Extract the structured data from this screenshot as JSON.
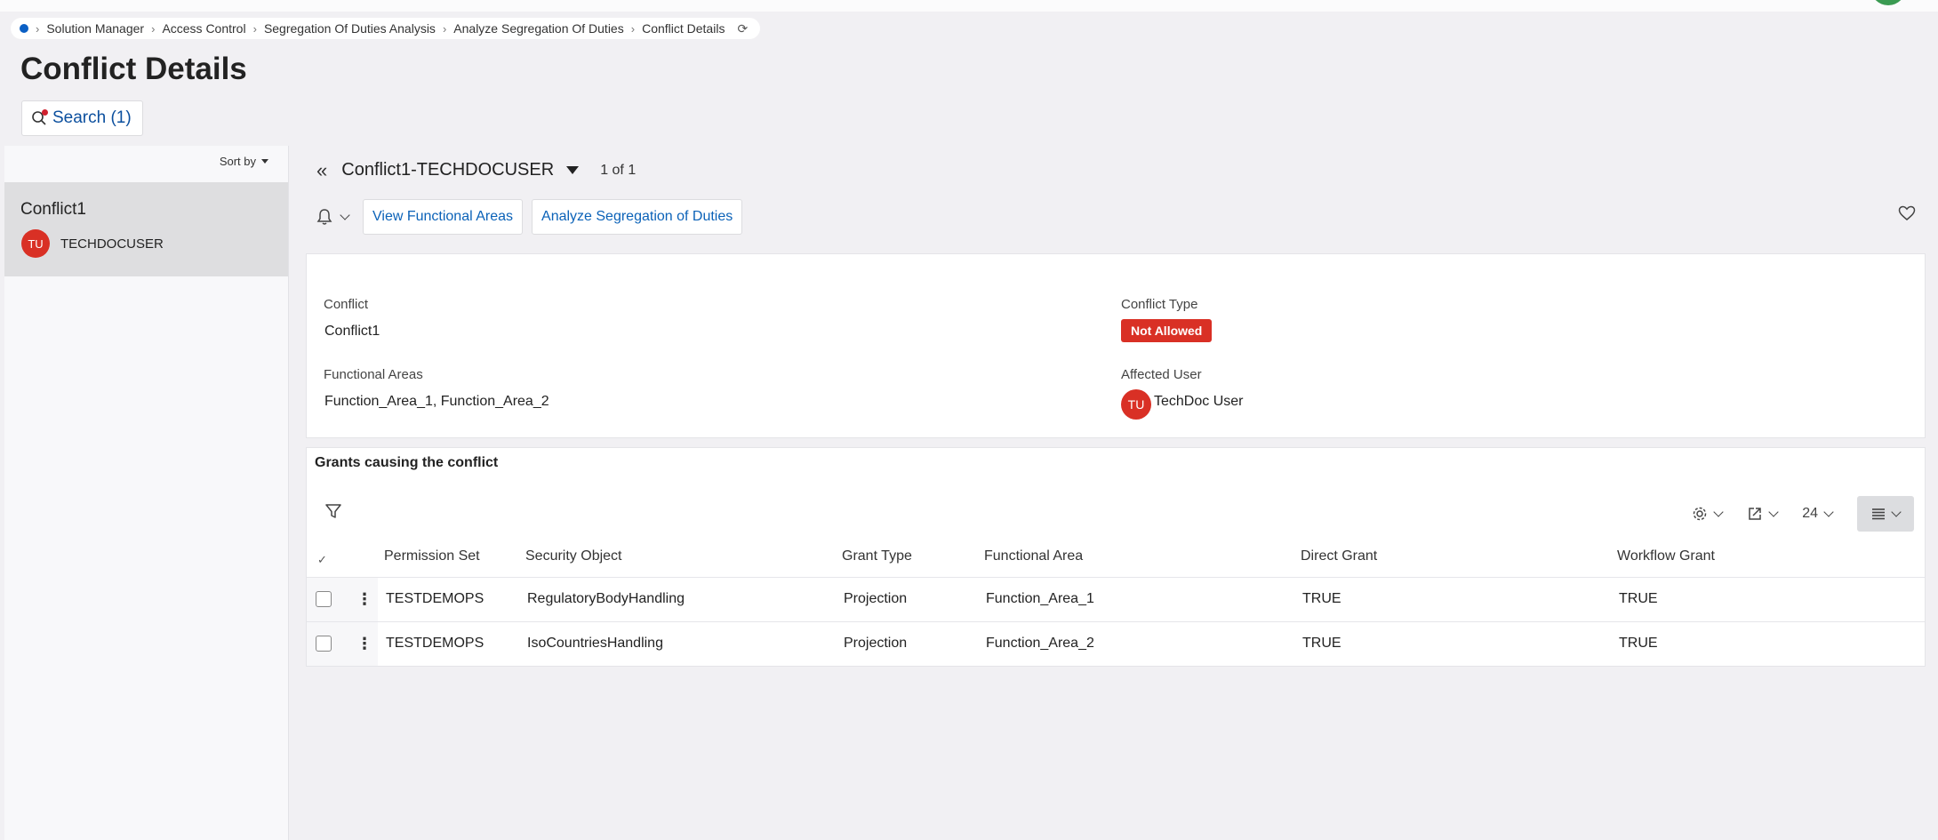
{
  "breadcrumb": {
    "items": [
      "Solution Manager",
      "Access Control",
      "Segregation Of Duties Analysis",
      "Analyze Segregation Of Duties",
      "Conflict Details"
    ],
    "refresh_icon": "refresh-icon"
  },
  "page": {
    "title": "Conflict Details"
  },
  "search": {
    "label": "Search (1)"
  },
  "list": {
    "sort_label": "Sort by",
    "items": [
      {
        "title": "Conflict1",
        "avatar": "TU",
        "user": "TECHDOCUSER"
      }
    ]
  },
  "record": {
    "title": "Conflict1-TECHDOCUSER",
    "count": "1 of 1"
  },
  "toolbar": {
    "view_functional_areas": "View Functional Areas",
    "analyze_sod": "Analyze Segregation of Duties"
  },
  "details": {
    "conflict_label": "Conflict",
    "conflict_value": "Conflict1",
    "conflict_type_label": "Conflict Type",
    "conflict_type_value": "Not Allowed",
    "functional_areas_label": "Functional Areas",
    "functional_areas_value": "Function_Area_1, Function_Area_2",
    "affected_user_label": "Affected User",
    "affected_user_avatar": "TU",
    "affected_user_value": "TechDoc User"
  },
  "grants": {
    "title": "Grants causing the conflict",
    "page_size": "24",
    "columns": [
      "Permission Set",
      "Security Object",
      "Grant Type",
      "Functional Area",
      "Direct Grant",
      "Workflow Grant"
    ],
    "rows": [
      [
        "TESTDEMOPS",
        "RegulatoryBodyHandling",
        "Projection",
        "Function_Area_1",
        "TRUE",
        "TRUE"
      ],
      [
        "TESTDEMOPS",
        "IsoCountriesHandling",
        "Projection",
        "Function_Area_2",
        "TRUE",
        "TRUE"
      ]
    ]
  },
  "colors": {
    "accent": "#0b62b8",
    "danger": "#d93025",
    "background": "#f1f0f3"
  }
}
